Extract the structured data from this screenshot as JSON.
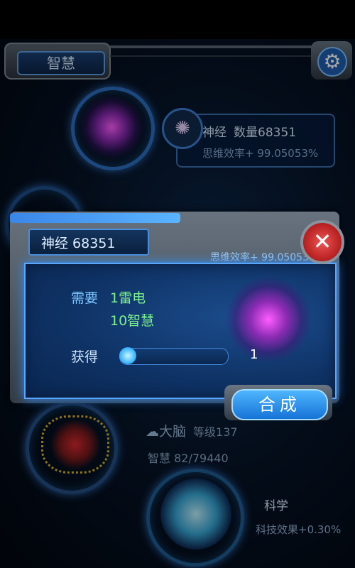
{
  "header": {
    "title": "智慧",
    "settings_icon": "gear-icon"
  },
  "top_node": {
    "name": "神经",
    "count_label": "数量68351",
    "rate": "思维效率+ 99.05053%"
  },
  "dialog": {
    "title": "神经 68351",
    "rate": "思维效率+ 99.05053%",
    "require_label": "需要",
    "requirements": [
      "1雷电",
      "10智慧"
    ],
    "gain_label": "获得",
    "quantity": "1",
    "slider_fraction": 0.0,
    "combine_label": "合成",
    "close_icon": "close-icon"
  },
  "brain": {
    "icon": "brain-icon",
    "name": "大脑",
    "level": "等级137",
    "wisdom": "智慧  82/79440"
  },
  "science": {
    "name": "科学",
    "effect": "科技效果+0.30%"
  },
  "colors": {
    "accent": "#2f8fff",
    "green_text": "#7df08f",
    "close_red": "#d63b3b"
  }
}
